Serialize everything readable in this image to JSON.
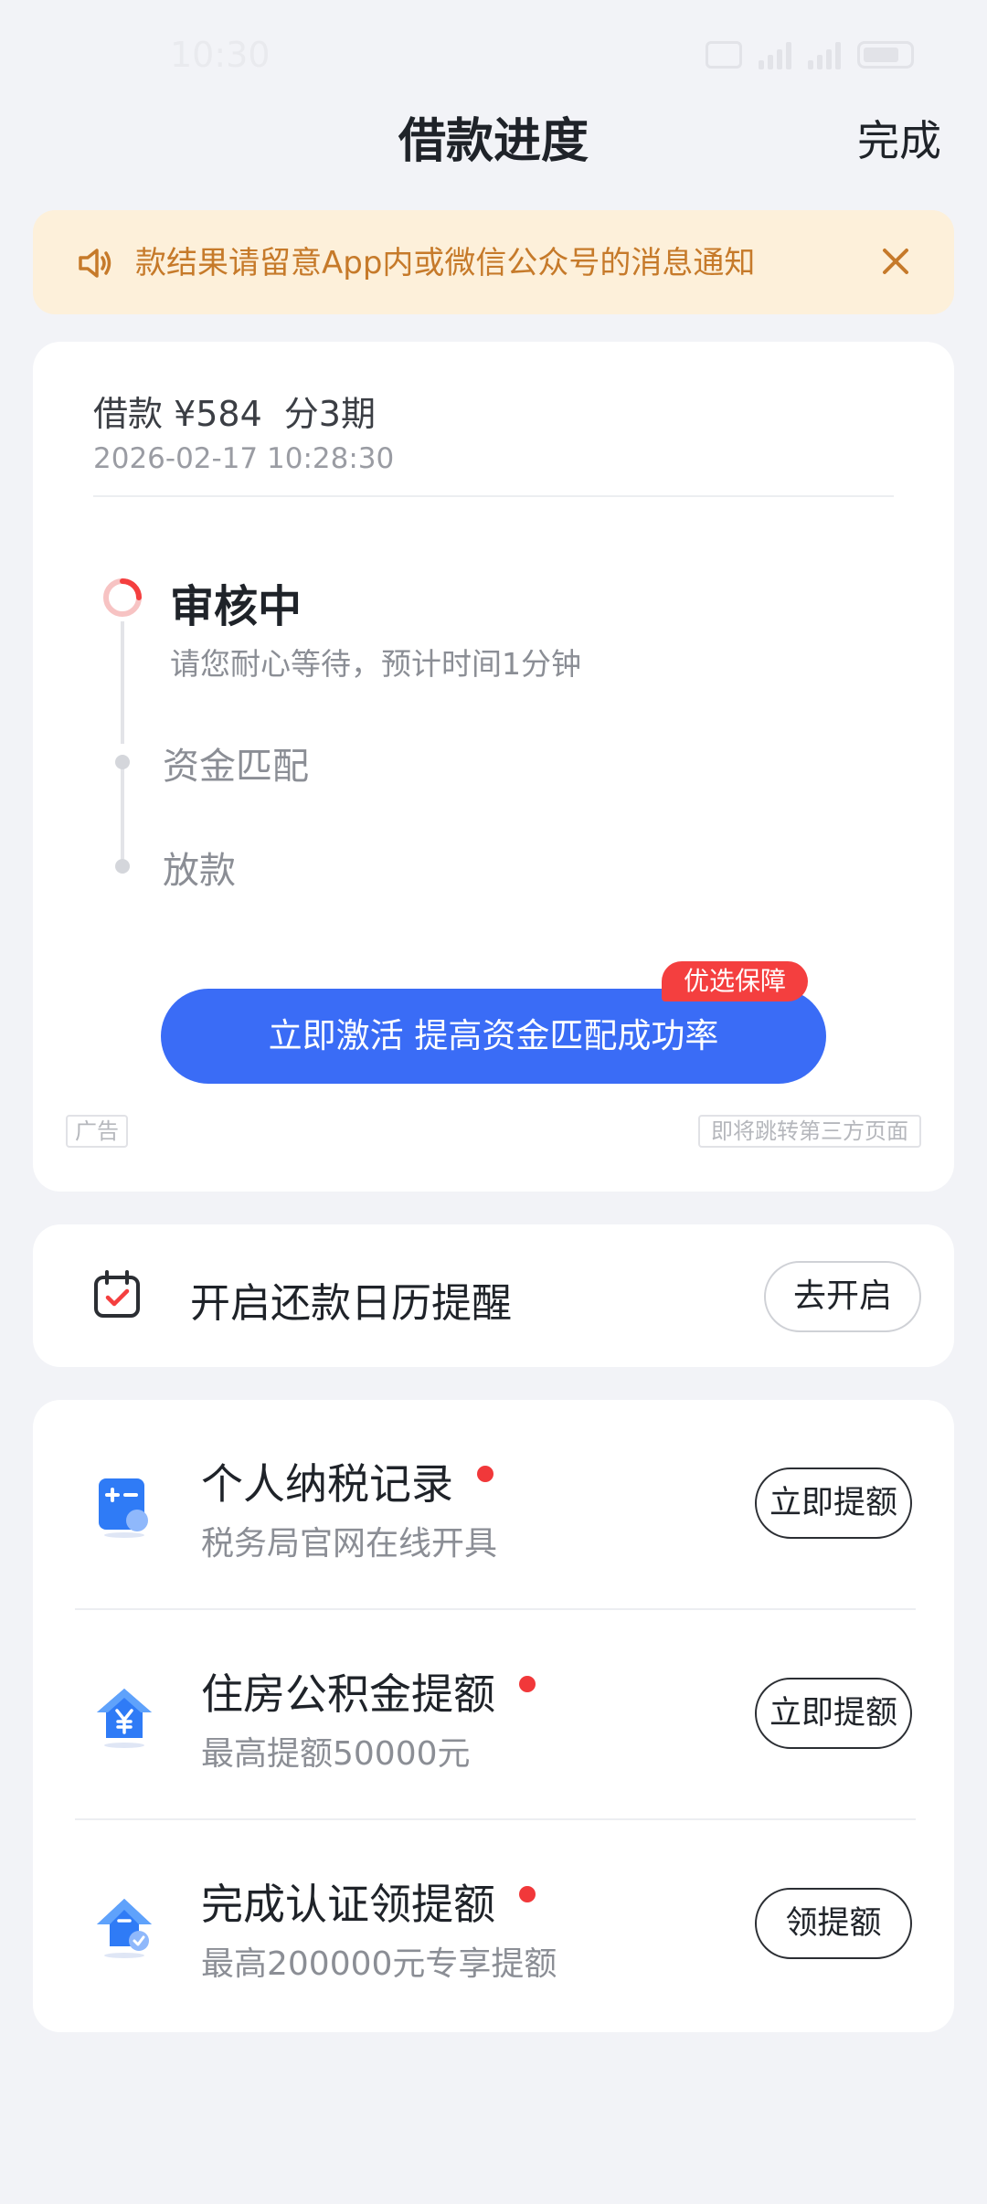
{
  "status_bar": {
    "time": "10:30"
  },
  "header": {
    "title": "借款进度",
    "done_label": "完成"
  },
  "notice": {
    "text": "款结果请留意App内或微信公众号的消息通知",
    "icon": "speaker-icon",
    "close_icon": "close-icon"
  },
  "loan": {
    "summary_amount": "借款 ¥584",
    "summary_terms": "分3期",
    "datetime": "2026-02-17 10:28:30"
  },
  "timeline": {
    "current": {
      "title": "审核中",
      "desc": "请您耐心等待，预计时间1分钟"
    },
    "steps": [
      "资金匹配",
      "放款"
    ]
  },
  "cta": {
    "label": "立即激活 提高资金匹配成功率",
    "badge": "优选保障",
    "ad_tag": "广告",
    "third_party_tag": "即将跳转第三方页面"
  },
  "calendar": {
    "text": "开启还款日历提醒",
    "button": "去开启",
    "icon": "calendar-check-icon"
  },
  "list": [
    {
      "title": "个人纳税记录",
      "subtitle": "税务局官网在线开具",
      "button": "立即提额",
      "icon": "calculator-icon"
    },
    {
      "title": "住房公积金提额",
      "subtitle": "最高提额50000元",
      "button": "立即提额",
      "icon": "house-yuan-icon"
    },
    {
      "title": "完成认证领提额",
      "subtitle": "最高200000元专享提额",
      "button": "领提额",
      "icon": "upgrade-arrow-icon"
    }
  ],
  "colors": {
    "primary": "#3a6cf6",
    "badge_red": "#f43f3f",
    "notice_bg": "#fdf0da",
    "notice_text": "#c67a2a",
    "page_bg": "#f2f3f7"
  }
}
